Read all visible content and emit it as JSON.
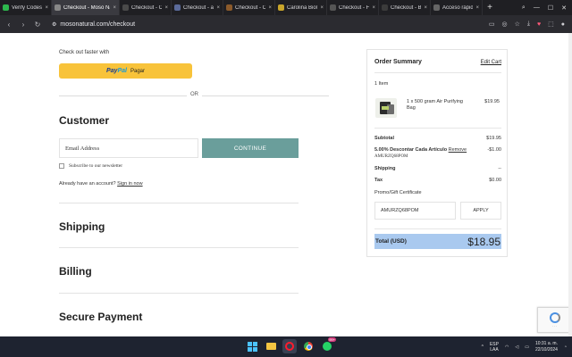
{
  "browser": {
    "tabs": [
      {
        "label": "Verify Codes",
        "active": false,
        "color": "#2db84d"
      },
      {
        "label": "Checkout - Moso Natural",
        "active": true,
        "color": "#888888"
      },
      {
        "label": "Checkout - Clearly",
        "active": false,
        "color": "#4a4a4a"
      },
      {
        "label": "Checkout - aurLin",
        "active": false,
        "color": "#5b6b9b"
      },
      {
        "label": "Checkout - Choffy",
        "active": false,
        "color": "#8b5a2b"
      },
      {
        "label": "Carolina Biological",
        "active": false,
        "color": "#c8a52b"
      },
      {
        "label": "Checkout - Flower",
        "active": false,
        "color": "#555555"
      },
      {
        "label": "Checkout - Bloom",
        "active": false,
        "color": "#3b3b3b"
      },
      {
        "label": "Acceso rápido",
        "active": false,
        "color": "#666666"
      }
    ],
    "url": "mosonatural.com/checkout"
  },
  "checkout": {
    "faster_text": "Check out faster with",
    "paypal_brand_1": "Pay",
    "paypal_brand_2": "Pal",
    "paypal_label": "Pagar",
    "or_text": "OR",
    "customer_title": "Customer",
    "email_placeholder": "Email Address",
    "continue_label": "CONTINUE",
    "subscribe_label": "Subscribe to our newsletter",
    "account_text": "Already have an account?",
    "signin_label": "Sign in now",
    "shipping_title": "Shipping",
    "billing_title": "Billing",
    "payment_title": "Secure Payment"
  },
  "summary": {
    "title": "Order Summary",
    "edit_cart": "Edit Cart",
    "item_count": "1 Item",
    "item_name": "1 x 500 gram Air Purifying Bag",
    "item_price": "$19.95",
    "subtotal_label": "Subtotal",
    "subtotal_value": "$19.95",
    "discount_label": "5.00% Descontar Cada Artículo",
    "discount_remove": "Remove",
    "discount_code": "AMURZQ68POM",
    "discount_value": "-$1.00",
    "shipping_label": "Shipping",
    "shipping_value": "--",
    "tax_label": "Tax",
    "tax_value": "$0.00",
    "promo_label": "Promo/Gift Certificate",
    "promo_value": "AMURZQ68POM",
    "apply_label": "APPLY",
    "total_label": "Total (USD)",
    "total_value": "$18.95"
  },
  "taskbar": {
    "lang_1": "ESP",
    "lang_2": "LAA",
    "time": "10:31 a. m.",
    "date": "22/10/2024",
    "whatsapp_badge": "99+"
  },
  "colors": {
    "accent_continue": "#6a9e9b",
    "paypal_yellow": "#f8c33a",
    "total_highlight": "#a9c9ef"
  }
}
